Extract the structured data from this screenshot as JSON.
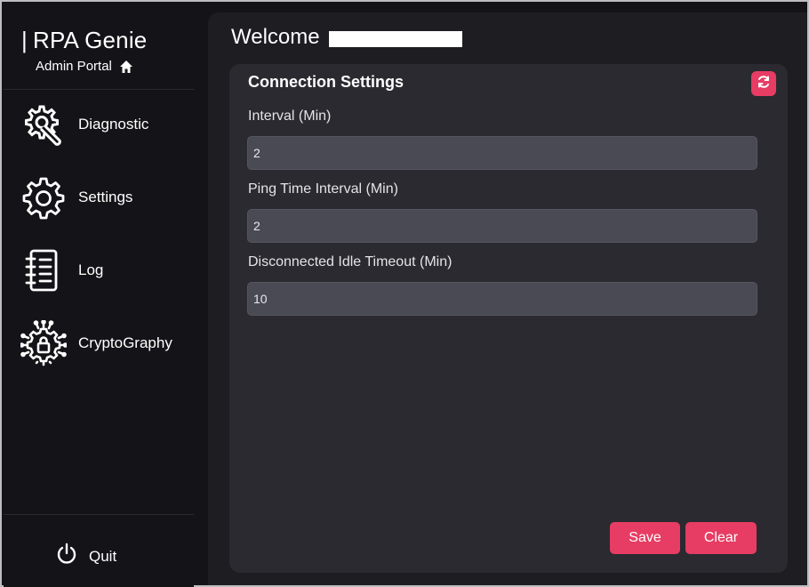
{
  "app": {
    "name": "RPA Genie",
    "subtitle": "Admin Portal"
  },
  "sidebar": {
    "items": [
      {
        "label": "Diagnostic",
        "icon": "diagnostic-gear-wrench-icon"
      },
      {
        "label": "Settings",
        "icon": "gear-icon"
      },
      {
        "label": "Log",
        "icon": "log-notebook-icon"
      },
      {
        "label": "CryptoGraphy",
        "icon": "lock-gear-icon"
      }
    ],
    "quit": {
      "label": "Quit",
      "icon": "power-icon"
    }
  },
  "header": {
    "welcome": "Welcome"
  },
  "card": {
    "title": "Connection Settings",
    "refresh_icon": "refresh-icon",
    "fields": [
      {
        "label": "Interval (Min)",
        "value": "2"
      },
      {
        "label": "Ping Time Interval (Min)",
        "value": "2"
      },
      {
        "label": "Disconnected Idle Timeout (Min)",
        "value": "10"
      }
    ],
    "buttons": {
      "save": "Save",
      "clear": "Clear"
    }
  },
  "colors": {
    "accent": "#e73c63",
    "background": "#141418",
    "panel": "#1d1d22",
    "card": "#2a2a30",
    "input": "#4a4a54"
  }
}
